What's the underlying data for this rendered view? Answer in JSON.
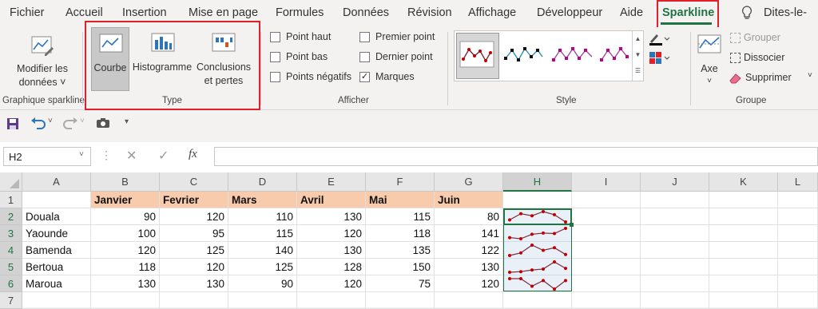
{
  "tabs": [
    "Fichier",
    "Accueil",
    "Insertion",
    "Mise en page",
    "Formules",
    "Données",
    "Révision",
    "Affichage",
    "Développeur",
    "Aide",
    "Sparkline"
  ],
  "tell_me": "Dites-le-",
  "ribbon": {
    "edit": {
      "label1": "Modifier les",
      "label2": "données",
      "group": "Graphique sparkline"
    },
    "type": {
      "line": "Courbe",
      "column": "Histogramme",
      "winloss1": "Conclusions",
      "winloss2": "et pertes",
      "group": "Type"
    },
    "show": {
      "high": "Point haut",
      "low": "Point bas",
      "negative": "Points négatifs",
      "first": "Premier point",
      "last": "Dernier point",
      "markers": "Marques",
      "group": "Afficher",
      "markers_checked": true
    },
    "style": {
      "group": "Style"
    },
    "group": {
      "axis": "Axe",
      "group_btn": "Grouper",
      "ungroup": "Dissocier",
      "clear": "Supprimer",
      "group": "Groupe"
    }
  },
  "name_box": "H2",
  "fx_label": "fx",
  "columns": [
    "A",
    "B",
    "C",
    "D",
    "E",
    "F",
    "G",
    "H",
    "I",
    "J",
    "K",
    "L"
  ],
  "rows": [
    "1",
    "2",
    "3",
    "4",
    "5",
    "6",
    "7"
  ],
  "headers": [
    "Janvier",
    "Fevrier",
    "Mars",
    "Avril",
    "Mai",
    "Juin"
  ],
  "cities": [
    "Douala",
    "Yaounde",
    "Bamenda",
    "Bertoua",
    "Maroua"
  ],
  "values": [
    [
      90,
      120,
      110,
      130,
      115,
      80
    ],
    [
      100,
      95,
      115,
      120,
      118,
      141
    ],
    [
      120,
      125,
      140,
      130,
      135,
      122
    ],
    [
      118,
      120,
      125,
      128,
      150,
      130
    ],
    [
      130,
      130,
      90,
      120,
      75,
      120
    ]
  ],
  "colors": {
    "accent": "#217346",
    "sparkline": "#7b2c3a",
    "marker": "#c00000",
    "highlight": "#e0202a"
  }
}
